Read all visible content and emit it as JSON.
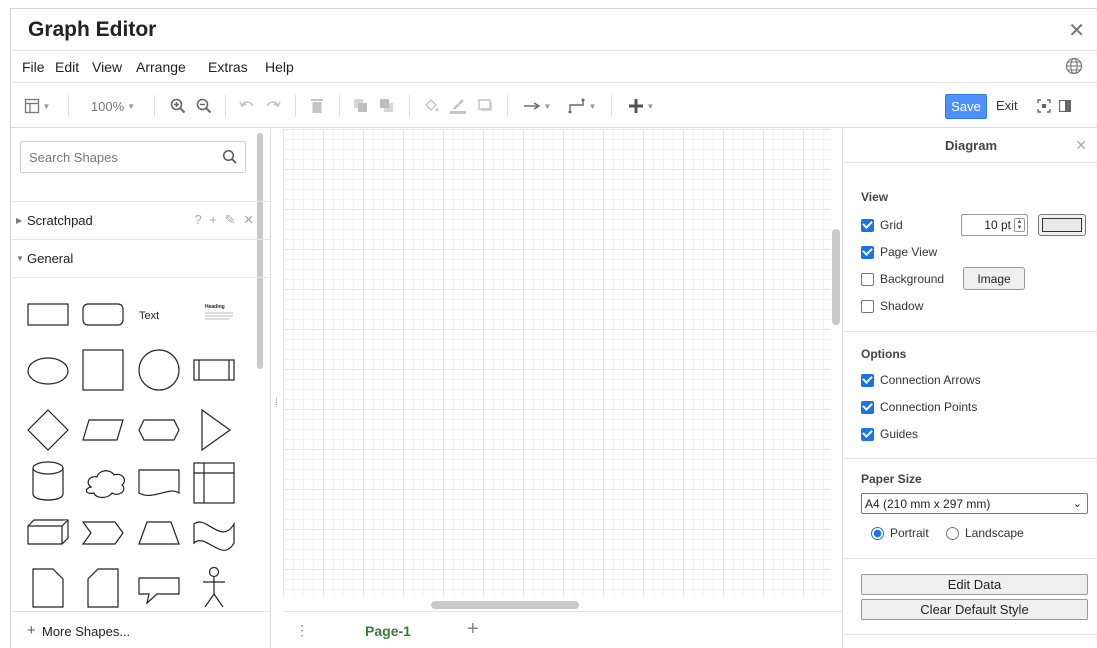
{
  "window": {
    "title": "Graph Editor",
    "close_glyph": "✕"
  },
  "menu": {
    "items": [
      "File",
      "Edit",
      "View",
      "Arrange",
      "Extras",
      "Help"
    ],
    "right_icon": "globe-icon"
  },
  "toolbar": {
    "zoom": "100%",
    "save_label": "Save",
    "exit_label": "Exit"
  },
  "sidebar": {
    "search_placeholder": "Search Shapes",
    "sections": [
      {
        "label": "Scratchpad",
        "expanded": false,
        "actions": "? + ✎ ✕"
      },
      {
        "label": "General",
        "expanded": true
      }
    ],
    "shape_text_label": "Text",
    "shape_heading_label": "Heading",
    "more_shapes": "More Shapes..."
  },
  "canvas": {
    "grid": true,
    "page_tab": "Page-1",
    "menu_glyph": "⋮",
    "add_glyph": "+"
  },
  "panel": {
    "title": "Diagram",
    "close_glyph": "✕",
    "view": {
      "heading": "View",
      "grid_label": "Grid",
      "grid_checked": true,
      "grid_size": "10 pt",
      "page_view_label": "Page View",
      "page_view_checked": true,
      "background_label": "Background",
      "background_checked": false,
      "image_button": "Image",
      "shadow_label": "Shadow",
      "shadow_checked": false
    },
    "options": {
      "heading": "Options",
      "connection_arrows": "Connection Arrows",
      "connection_points": "Connection Points",
      "guides": "Guides"
    },
    "paper": {
      "heading": "Paper Size",
      "selected": "A4 (210 mm x 297 mm)",
      "portrait": "Portrait",
      "landscape": "Landscape",
      "orientation": "Portrait"
    },
    "buttons": {
      "edit_data": "Edit Data",
      "clear_style": "Clear Default Style"
    }
  },
  "colors": {
    "accent": "#4d90fe",
    "page_tab": "#3a7b3a",
    "checkbox": "#1a73e8"
  }
}
